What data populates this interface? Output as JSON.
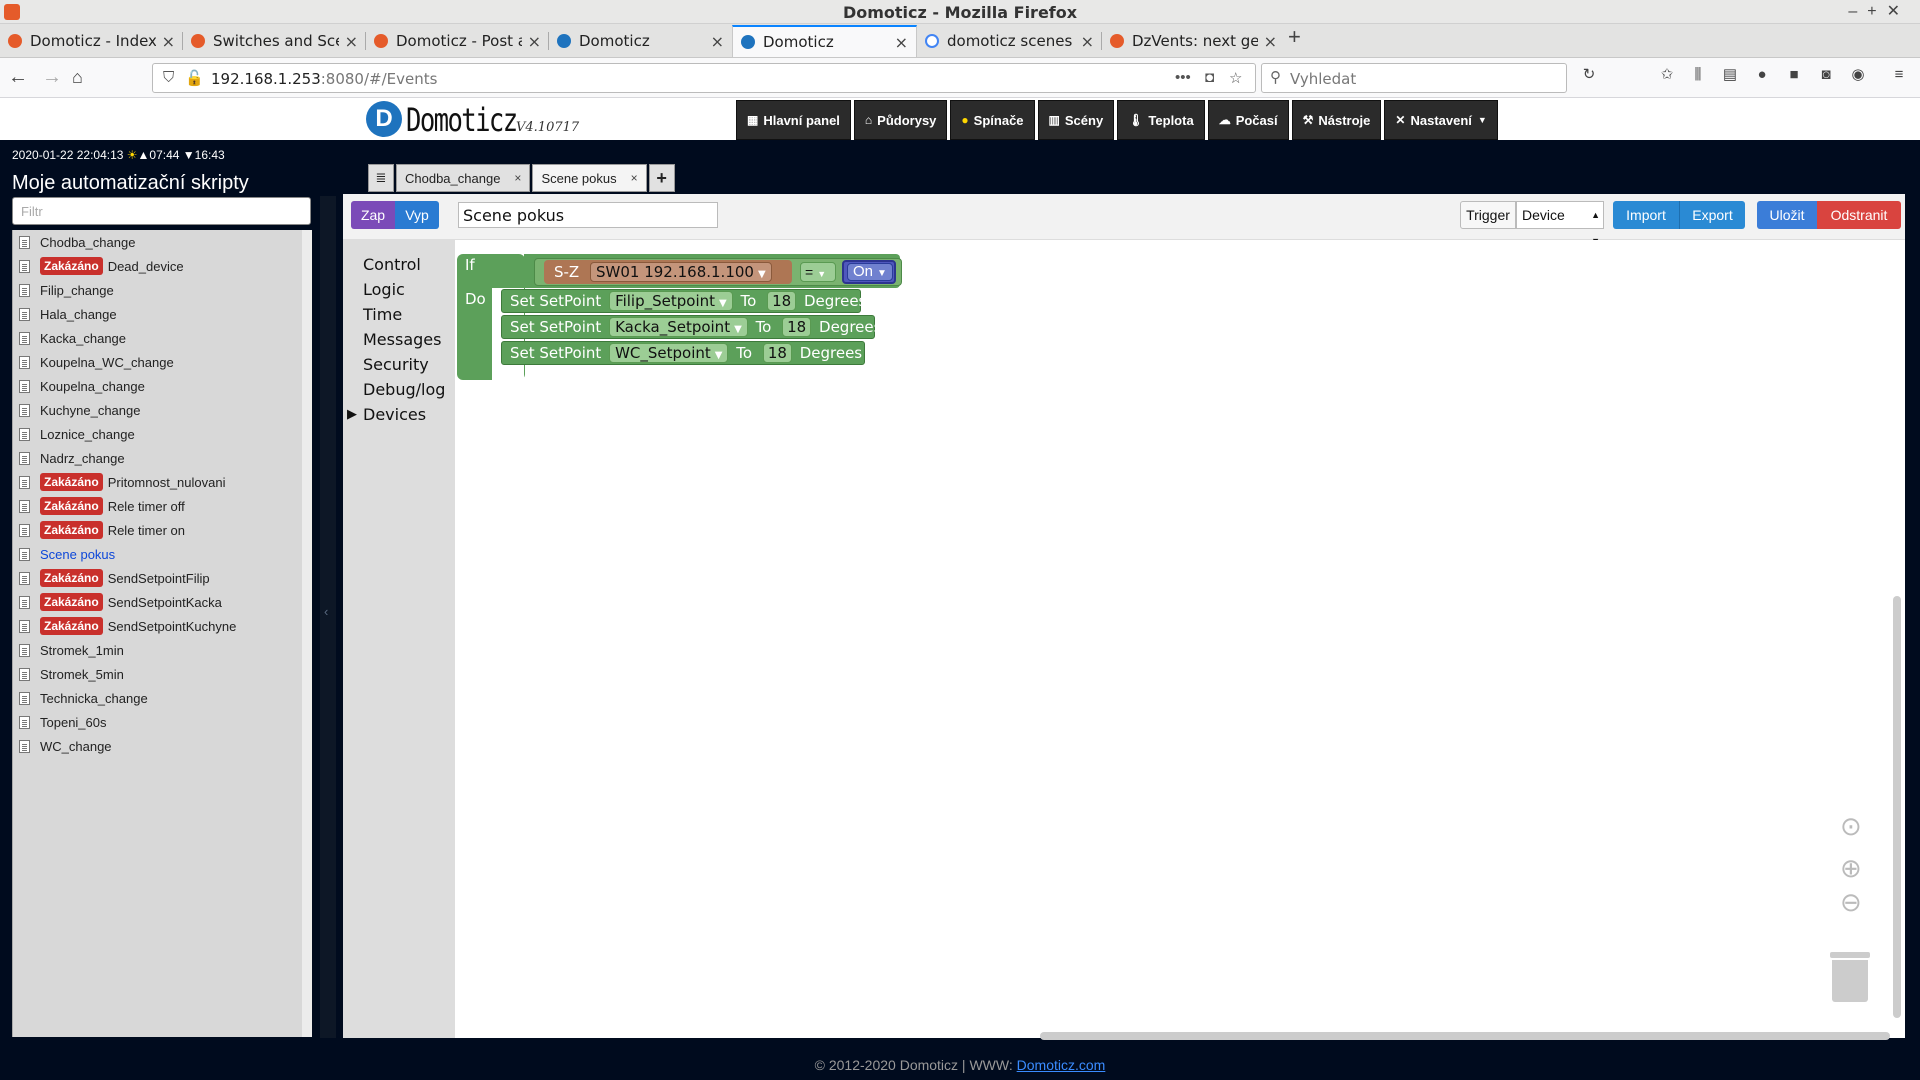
{
  "browser": {
    "window_title": "Domoticz - Mozilla Firefox",
    "tabs": [
      {
        "label": "Domoticz - Index page",
        "icon": "domoticz-orange"
      },
      {
        "label": "Switches and Scenes - D",
        "icon": "domoticz-orange"
      },
      {
        "label": "Domoticz - Post a reply",
        "icon": "domoticz-orange"
      },
      {
        "label": "Domoticz",
        "icon": "domoticz-blue"
      },
      {
        "label": "Domoticz",
        "icon": "domoticz-blue"
      },
      {
        "label": "domoticz scenes - Hleda",
        "icon": "google"
      },
      {
        "label": "DzVents: next generatio",
        "icon": "domoticz-orange"
      }
    ],
    "url_host": "192.168.1.253",
    "url_rest": ":8080/#/Events",
    "search_placeholder": "Vyhledat"
  },
  "header": {
    "logo_text": "Domoticz",
    "version": "V4.10717",
    "menu": [
      {
        "label": "Hlavní panel",
        "icon": "dashboard-icon"
      },
      {
        "label": "Půdorysy",
        "icon": "floorplan-icon"
      },
      {
        "label": "Spínače",
        "icon": "bulb-icon"
      },
      {
        "label": "Scény",
        "icon": "scene-icon"
      },
      {
        "label": "Teplota",
        "icon": "thermometer-icon"
      },
      {
        "label": "Počasí",
        "icon": "weather-icon"
      },
      {
        "label": "Nástroje",
        "icon": "tools-icon"
      },
      {
        "label": "Nastavení",
        "icon": "settings-icon"
      }
    ]
  },
  "status": {
    "datetime": "2020-01-22 22:04:13",
    "sunrise": "▲07:44",
    "sunset": "▼16:43"
  },
  "sidebar": {
    "title": "Moje automatizační skripty",
    "filter_placeholder": "Filtr",
    "disabled_label": "Zakázáno",
    "scripts": [
      {
        "name": "Chodba_change",
        "disabled": false
      },
      {
        "name": "Dead_device",
        "disabled": true
      },
      {
        "name": "Filip_change",
        "disabled": false
      },
      {
        "name": "Hala_change",
        "disabled": false
      },
      {
        "name": "Kacka_change",
        "disabled": false
      },
      {
        "name": "Koupelna_WC_change",
        "disabled": false
      },
      {
        "name": "Koupelna_change",
        "disabled": false
      },
      {
        "name": "Kuchyne_change",
        "disabled": false
      },
      {
        "name": "Loznice_change",
        "disabled": false
      },
      {
        "name": "Nadrz_change",
        "disabled": false
      },
      {
        "name": "Pritomnost_nulovani",
        "disabled": true
      },
      {
        "name": "Rele timer off",
        "disabled": true
      },
      {
        "name": "Rele timer on",
        "disabled": true
      },
      {
        "name": "Scene pokus",
        "disabled": false,
        "selected": true
      },
      {
        "name": "SendSetpointFilip",
        "disabled": true
      },
      {
        "name": "SendSetpointKacka",
        "disabled": true
      },
      {
        "name": "SendSetpointKuchyne",
        "disabled": true
      },
      {
        "name": "Stromek_1min",
        "disabled": false
      },
      {
        "name": "Stromek_5min",
        "disabled": false
      },
      {
        "name": "Technicka_change",
        "disabled": false
      },
      {
        "name": "Topeni_60s",
        "disabled": false
      },
      {
        "name": "WC_change",
        "disabled": false
      }
    ]
  },
  "editor_tabs": [
    {
      "label": "Chodba_change",
      "active": false
    },
    {
      "label": "Scene pokus",
      "active": true
    }
  ],
  "toolbar": {
    "zap": "Zap",
    "vyp": "Vyp",
    "event_name": "Scene pokus",
    "trigger_label": "Trigger",
    "trigger_value": "Device",
    "import": "Import",
    "export": "Export",
    "save": "Uložit",
    "delete": "Odstranit"
  },
  "toolbox": [
    "Control",
    "Logic",
    "Time",
    "Messages",
    "Security",
    "Debug/log",
    "Devices"
  ],
  "blocks": {
    "if_label": "If",
    "do_label": "Do",
    "device_prefix": "S-Z",
    "device_name": "SW01    192.168.1.100",
    "operator": "=",
    "value": "On",
    "setpoints": [
      {
        "prefix": "Set SetPoint",
        "device": "Filip_Setpoint",
        "to": "To",
        "value": "18",
        "unit": "Degrees"
      },
      {
        "prefix": "Set SetPoint",
        "device": "Kacka_Setpoint",
        "to": "To",
        "value": "18",
        "unit": "Degrees"
      },
      {
        "prefix": "Set SetPoint",
        "device": "WC_Setpoint",
        "to": "To",
        "value": "18",
        "unit": "Degrees"
      }
    ]
  },
  "footer": {
    "text": "© 2012-2020 Domoticz | WWW: ",
    "link": "Domoticz.com"
  }
}
